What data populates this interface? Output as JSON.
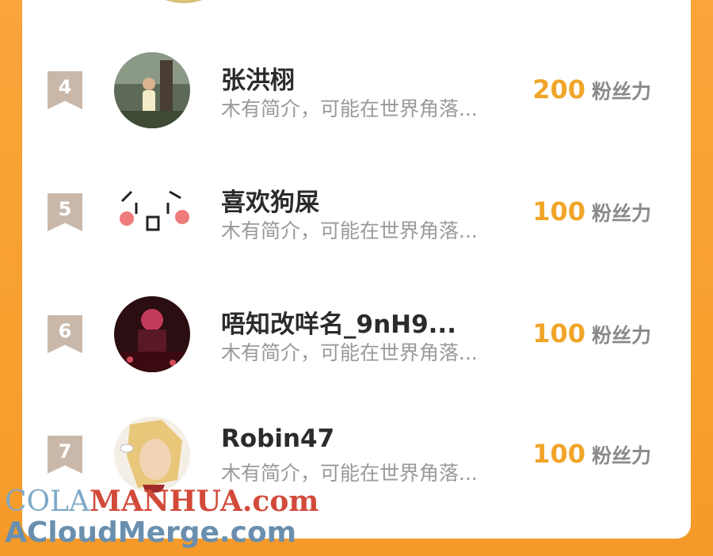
{
  "ranking": {
    "rows": [
      {
        "rank": "4",
        "name": "张洪栩",
        "bio": "木有简介，可能在世界角落...",
        "fans_value": "200",
        "fans_unit": "粉丝力"
      },
      {
        "rank": "5",
        "name": "喜欢狗屎",
        "bio": "木有简介，可能在世界角落...",
        "fans_value": "100",
        "fans_unit": "粉丝力"
      },
      {
        "rank": "6",
        "name": "唔知改咩名_9nH9...",
        "bio": "木有简介，可能在世界角落...",
        "fans_value": "100",
        "fans_unit": "粉丝力"
      },
      {
        "rank": "7",
        "name": "Robin47",
        "bio": "木有简介，可能在世界角落...",
        "fans_value": "100",
        "fans_unit": "粉丝力"
      }
    ]
  },
  "watermark": {
    "line1_part1": "COLA",
    "line1_part2": "MANHUA.com",
    "line2": "ACloudMerge.com"
  },
  "colors": {
    "accent": "#f0a52a",
    "background": "#f7a030",
    "rank_badge": "#c9b8aa"
  }
}
